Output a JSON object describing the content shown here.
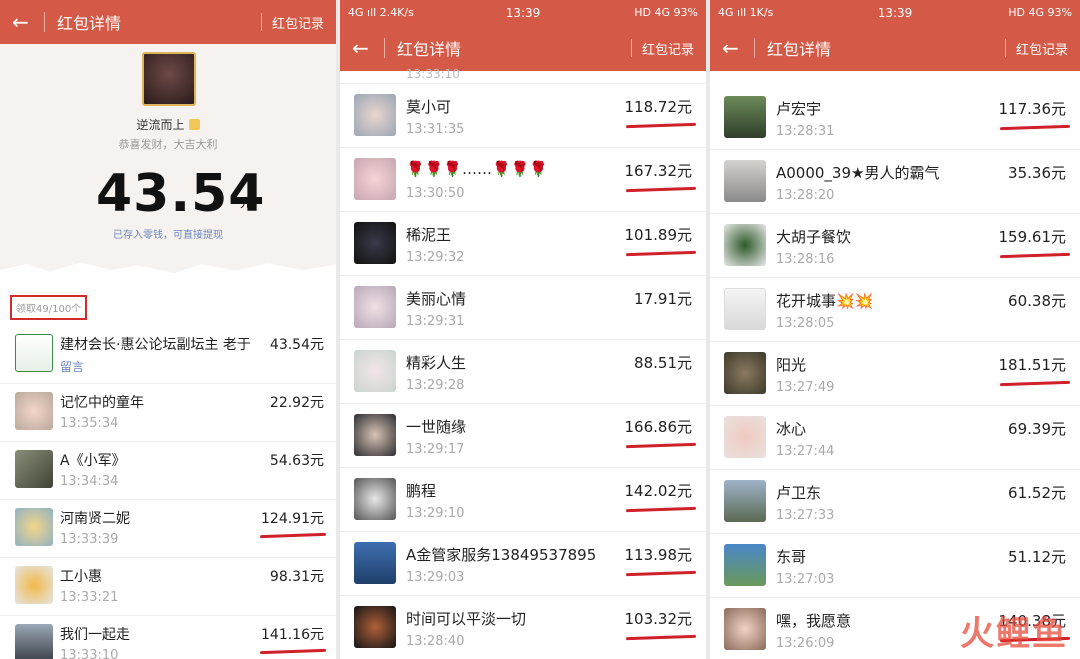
{
  "colors": {
    "header": "#d45a47",
    "underline": "#d0212a",
    "link": "#6a86c0",
    "highlight_box": "#d32a2a"
  },
  "icons": {
    "back": "←"
  },
  "panel1": {
    "header": {
      "title": "红包详情",
      "record": "红包记录"
    },
    "sender": {
      "name": "逆流而上",
      "wish": "恭喜发财，大吉大利"
    },
    "amount": "43.54",
    "unit": "元",
    "note": "已存入零钱，可直接提现",
    "count": "领取49/100个",
    "rows": [
      {
        "name": "建材会长·惠公论坛副坛主 老于",
        "amount": "43.54元",
        "memo": "留言"
      },
      {
        "name": "记忆中的童年",
        "time": "13:35:34",
        "amount": "22.92元"
      },
      {
        "name": "A《小军》",
        "time": "13:34:34",
        "amount": "54.63元"
      },
      {
        "name": "河南贤二妮",
        "time": "13:33:39",
        "amount": "124.91元"
      },
      {
        "name": "工小惠",
        "time": "13:33:21",
        "amount": "98.31元"
      },
      {
        "name": "我们一起走",
        "time": "13:33:10",
        "amount": "141.16元"
      }
    ]
  },
  "panel2": {
    "status": {
      "left": "4G ıll 2.4K/s",
      "time": "13:39",
      "right": "HD 4G 93%"
    },
    "header": {
      "title": "红包详情",
      "record": "红包记录"
    },
    "partial_time": "13:33:10",
    "rows": [
      {
        "name": "莫小可",
        "time": "13:31:35",
        "amount": "118.72元"
      },
      {
        "name": "🌹🌹🌹……🌹🌹🌹",
        "time": "13:30:50",
        "amount": "167.32元"
      },
      {
        "name": "稀泥王",
        "time": "13:29:32",
        "amount": "101.89元"
      },
      {
        "name": "美丽心情",
        "time": "13:29:31",
        "amount": "17.91元"
      },
      {
        "name": "精彩人生",
        "time": "13:29:28",
        "amount": "88.51元"
      },
      {
        "name": "一世随缘",
        "time": "13:29:17",
        "amount": "166.86元"
      },
      {
        "name": "鹏程",
        "time": "13:29:10",
        "amount": "142.02元"
      },
      {
        "name": "A金管家服务13849537895",
        "time": "13:29:03",
        "amount": "113.98元"
      },
      {
        "name": "时间可以平淡一切",
        "time": "13:28:40",
        "amount": "103.32元"
      }
    ]
  },
  "panel3": {
    "status": {
      "left": "4G ıll 1K/s",
      "time": "13:39",
      "right": "HD 4G 93%"
    },
    "header": {
      "title": "红包详情",
      "record": "红包记录"
    },
    "rows": [
      {
        "name": "卢宏宇",
        "time": "13:28:31",
        "amount": "117.36元"
      },
      {
        "name": "A0000_39★男人的霸气",
        "time": "13:28:20",
        "amount": "35.36元"
      },
      {
        "name": "大胡子餐饮",
        "time": "13:28:16",
        "amount": "159.61元"
      },
      {
        "name": "花开城事💥💥",
        "time": "13:28:05",
        "amount": "60.38元"
      },
      {
        "name": "阳光",
        "time": "13:27:49",
        "amount": "181.51元"
      },
      {
        "name": "冰心",
        "time": "13:27:44",
        "amount": "69.39元"
      },
      {
        "name": "卢卫东",
        "time": "13:27:33",
        "amount": "61.52元"
      },
      {
        "name": "东哥",
        "time": "13:27:03",
        "amount": "51.12元"
      },
      {
        "name": "嘿，我愿意",
        "time": "13:26:09",
        "amount": "140.38元"
      }
    ]
  },
  "watermark": "火鲤鱼"
}
